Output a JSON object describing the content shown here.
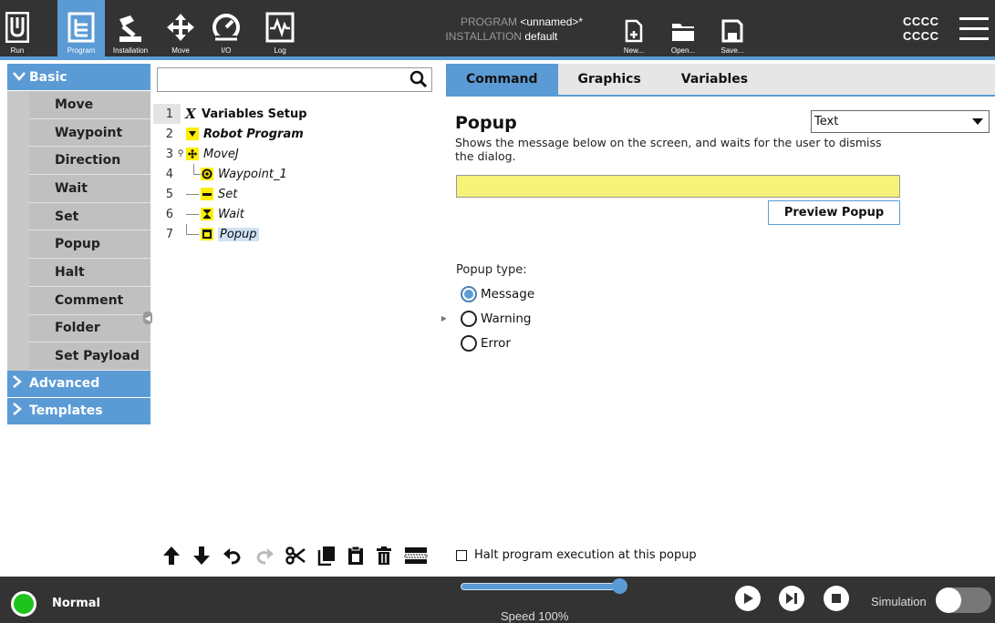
{
  "topbar": {
    "nav": [
      {
        "id": "run",
        "label": "Run",
        "icon": "ur-logo-icon"
      },
      {
        "id": "program",
        "label": "Program",
        "icon": "program-tree-icon",
        "active": true
      },
      {
        "id": "installation",
        "label": "Installation",
        "icon": "robot-arm-icon"
      },
      {
        "id": "move",
        "label": "Move",
        "icon": "move-arrows-icon"
      },
      {
        "id": "io",
        "label": "I/O",
        "icon": "io-gauge-icon"
      },
      {
        "id": "log",
        "label": "Log",
        "icon": "log-pulse-icon"
      }
    ],
    "program_key": "PROGRAM",
    "program_value": "<unnamed>*",
    "installation_key": "INSTALLATION",
    "installation_value": "default",
    "file_buttons": [
      {
        "id": "new",
        "label": "New...",
        "icon": "new-file-icon"
      },
      {
        "id": "open",
        "label": "Open...",
        "icon": "folder-open-icon"
      },
      {
        "id": "save",
        "label": "Save...",
        "icon": "floppy-disk-icon"
      }
    ],
    "user_line1": "CCCC",
    "user_line2": "CCCC",
    "accent_color": "#5b9bd5"
  },
  "palette": {
    "basic_label": "Basic",
    "items": [
      "Move",
      "Waypoint",
      "Direction",
      "Wait",
      "Set",
      "Popup",
      "Halt",
      "Comment",
      "Folder",
      "Set Payload"
    ],
    "advanced_label": "Advanced",
    "templates_label": "Templates"
  },
  "tree": {
    "rows": [
      {
        "num": "1",
        "label": "Variables Setup",
        "icon": "x-variable-icon"
      },
      {
        "num": "2",
        "label": "Robot Program",
        "icon": "triangle-down-icon"
      },
      {
        "num": "3",
        "label": "MoveJ",
        "icon": "move-arrows-icon"
      },
      {
        "num": "4",
        "label": "Waypoint_1",
        "icon": "waypoint-icon"
      },
      {
        "num": "5",
        "label": "Set",
        "icon": "set-icon"
      },
      {
        "num": "6",
        "label": "Wait",
        "icon": "hourglass-icon"
      },
      {
        "num": "7",
        "label": "Popup",
        "icon": "popup-window-icon"
      }
    ],
    "toolbar": [
      "move-up-icon",
      "move-down-icon",
      "undo-icon",
      "redo-icon",
      "cut-icon",
      "copy-icon",
      "paste-icon",
      "delete-icon",
      "suppress-icon"
    ]
  },
  "command": {
    "tabs": [
      "Command",
      "Graphics",
      "Variables"
    ],
    "title": "Popup",
    "description": "Shows the message below on the screen, and waits for the user to dismiss the dialog.",
    "type_select_value": "Text",
    "message_value": "",
    "preview_label": "Preview Popup",
    "popup_type_label": "Popup type:",
    "popup_types": [
      "Message",
      "Warning",
      "Error"
    ],
    "selected_type": "Message",
    "halt_label": "Halt program execution at this popup",
    "halt_checked": false
  },
  "bottombar": {
    "status": "Normal",
    "status_color": "#1ec31e",
    "speed_text": "Speed 100%",
    "speed_fraction": 1.0,
    "simulation_label": "Simulation",
    "simulation_on": false
  }
}
